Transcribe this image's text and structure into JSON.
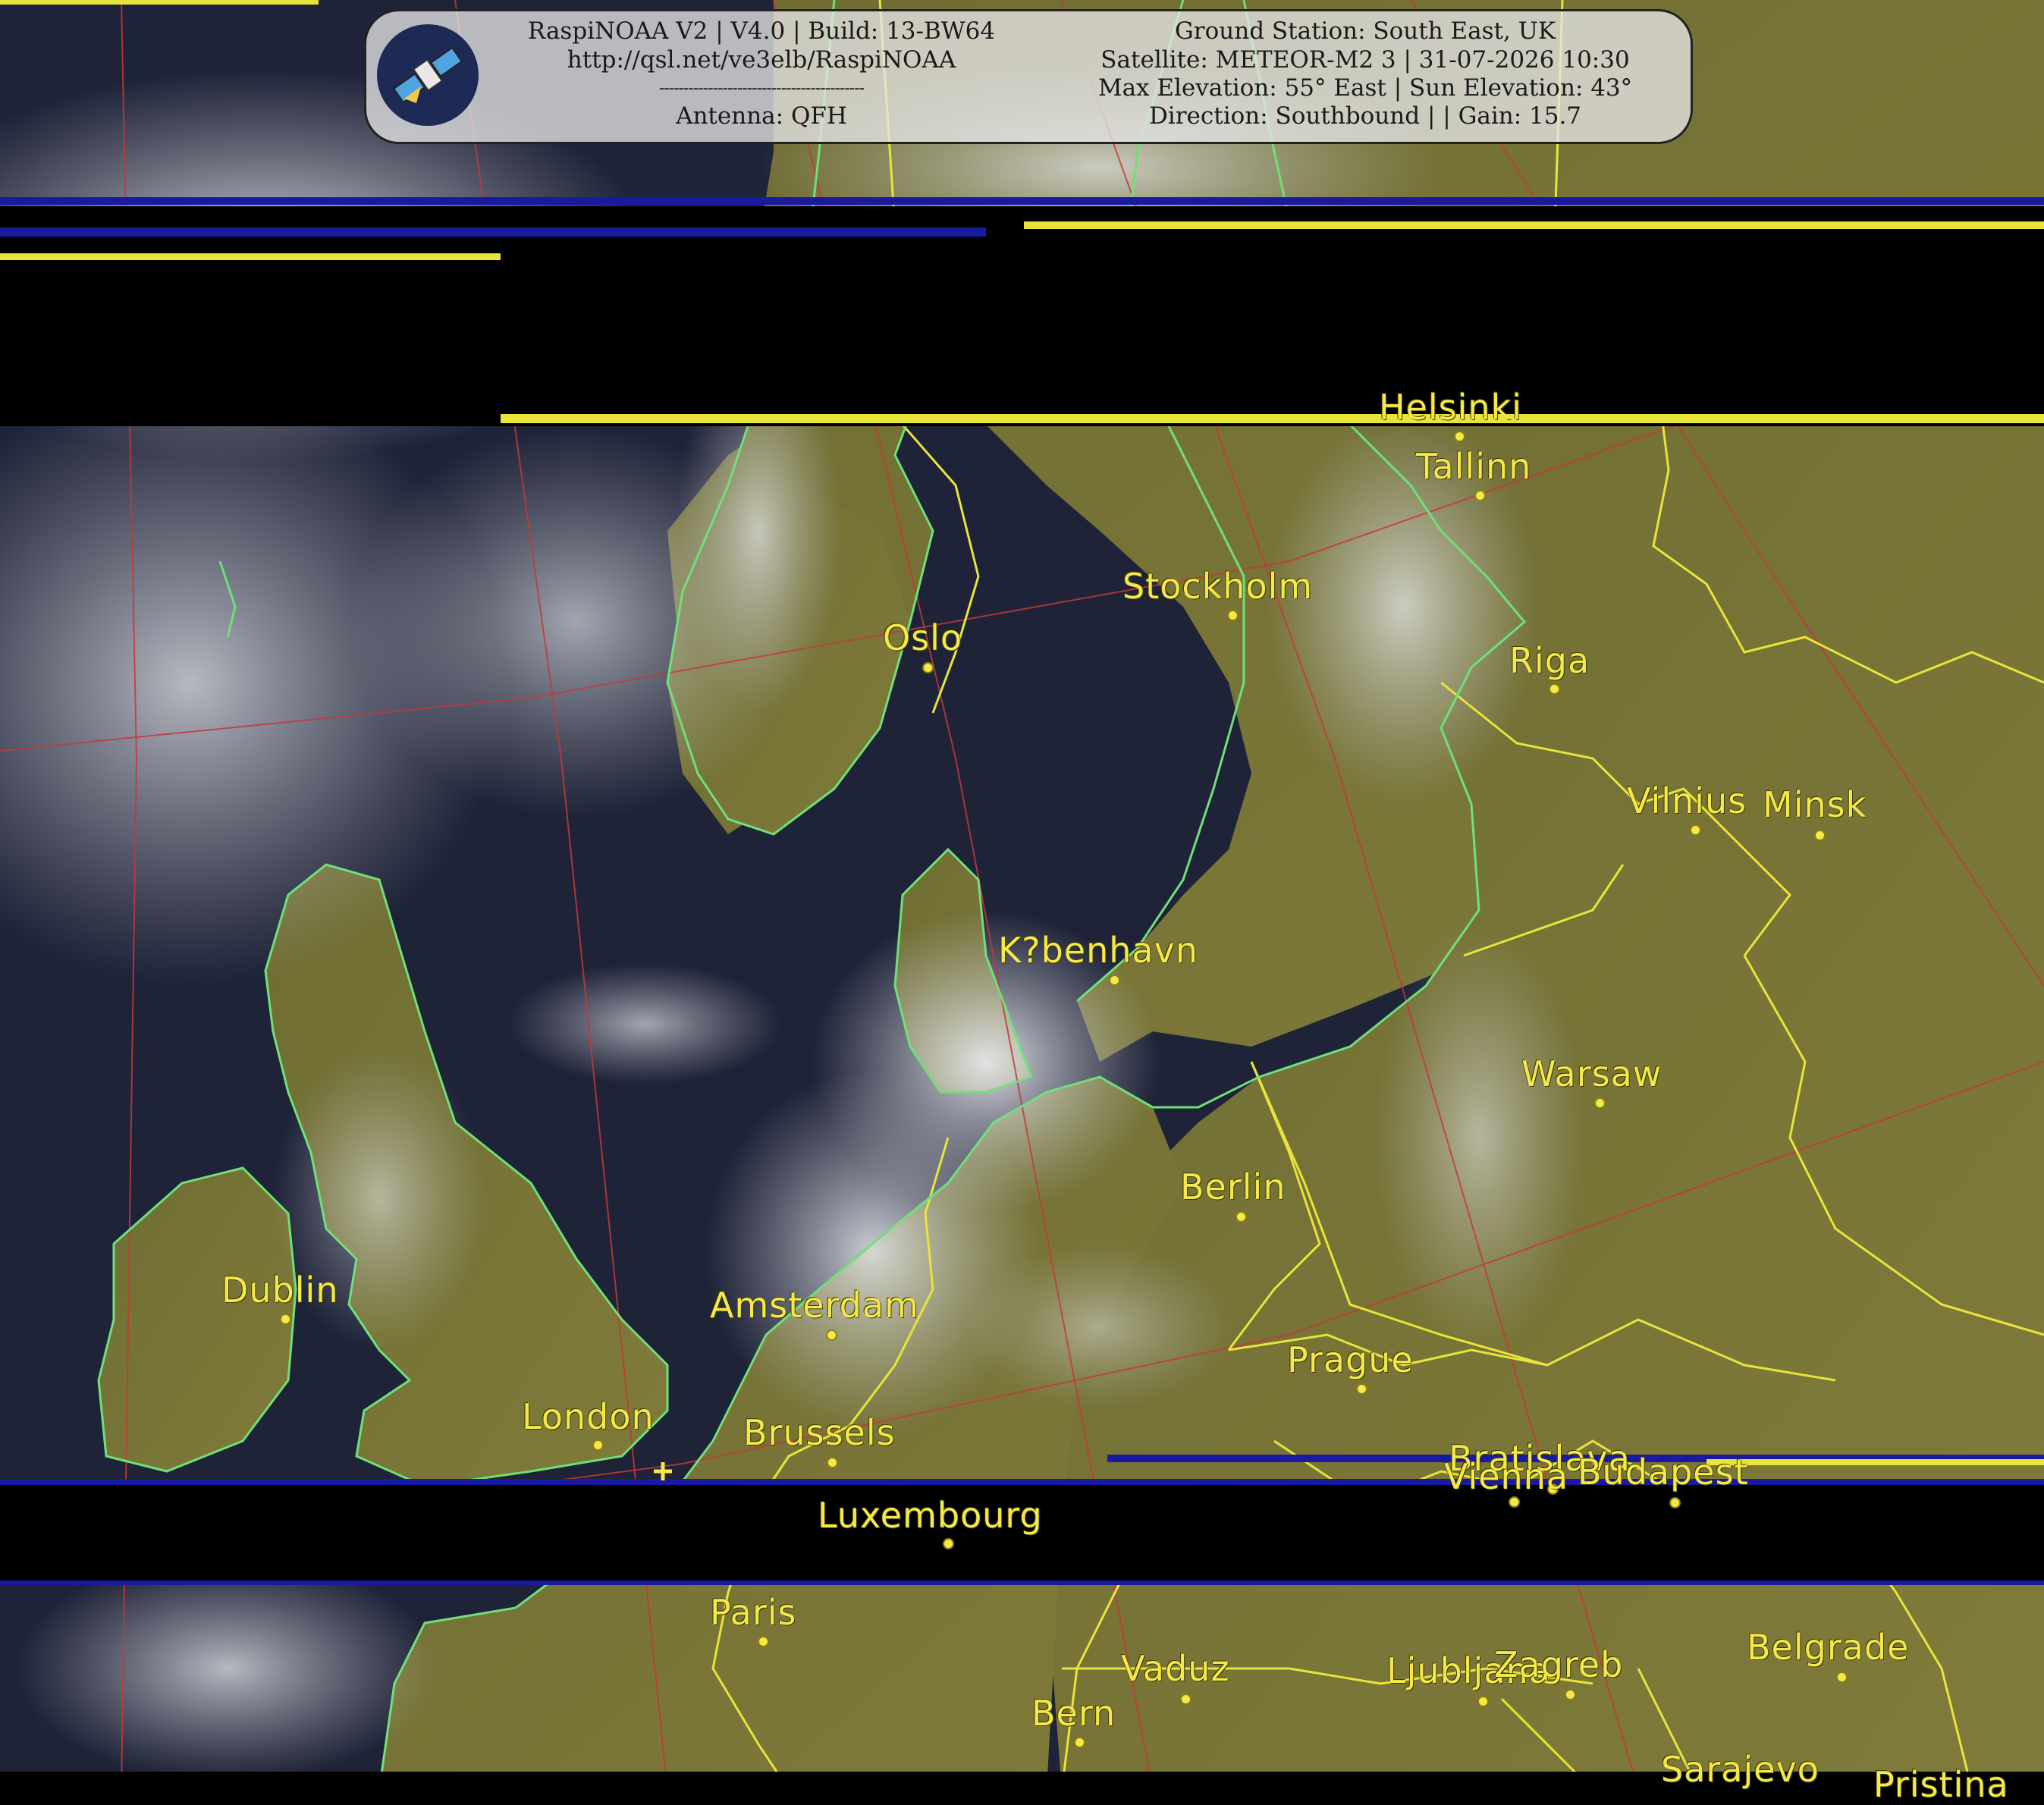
{
  "header": {
    "left_line1": "RaspiNOAA V2 | V4.0 | Build: 13-BW64",
    "left_line2": "http://qsl.net/ve3elb/RaspiNOAA",
    "left_line3": "------------------------------------------",
    "left_line4": "Antenna: QFH",
    "right_line1": "Ground Station: South East, UK",
    "right_line2": "Satellite: METEOR-M2 3 | 31-07-2026 10:30",
    "right_line3": "Max Elevation: 55° East | Sun Elevation: 43°",
    "right_line4": "Direction: Southbound | | Gain: 15.7"
  },
  "cities": [
    {
      "name": "Helsinki"
    },
    {
      "name": "Tallinn"
    },
    {
      "name": "Stockholm"
    },
    {
      "name": "Oslo"
    },
    {
      "name": "Riga"
    },
    {
      "name": "Vilnius"
    },
    {
      "name": "Minsk"
    },
    {
      "name": "K?benhavn"
    },
    {
      "name": "Warsaw"
    },
    {
      "name": "Berlin"
    },
    {
      "name": "Dublin"
    },
    {
      "name": "Amsterdam"
    },
    {
      "name": "Prague"
    },
    {
      "name": "London"
    },
    {
      "name": "Brussels"
    },
    {
      "name": "Bratislava"
    },
    {
      "name": "Vienna"
    },
    {
      "name": "Budapest"
    },
    {
      "name": "Luxembourg"
    },
    {
      "name": "Paris"
    },
    {
      "name": "Vaduz"
    },
    {
      "name": "Ljubljana"
    },
    {
      "name": "Zagreb"
    },
    {
      "name": "Belgrade"
    },
    {
      "name": "Bern"
    },
    {
      "name": "Sarajevo"
    },
    {
      "name": "Pristina"
    }
  ],
  "colors": {
    "coastline": "#6fe07a",
    "borders": "#e8e43a",
    "graticule": "#c23a3a",
    "label": "#f4e84a",
    "sea": "#1e2238",
    "land": "#7c7a3a",
    "cloud": "#cfd2d6"
  }
}
